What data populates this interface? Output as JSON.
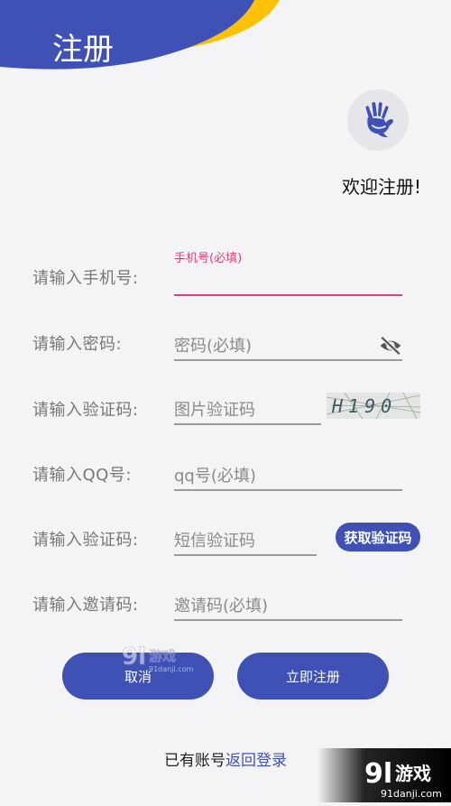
{
  "header": {
    "title": "注册"
  },
  "welcome": "欢迎注册!",
  "form": {
    "phone": {
      "label": "请输入手机号:",
      "floating_label": "手机号(必填)"
    },
    "password": {
      "label": "请输入密码:",
      "placeholder": "密码(必填)"
    },
    "captcha": {
      "label": "请输入验证码:",
      "placeholder": "图片验证码",
      "image_text": "H190"
    },
    "qq": {
      "label": "请输入QQ号:",
      "placeholder": "qq号(必填)"
    },
    "sms": {
      "label": "请输入验证码:",
      "placeholder": "短信验证码",
      "button_label": "获取验证码"
    },
    "invite": {
      "label": "请输入邀请码:",
      "placeholder": "邀请码(必填)"
    }
  },
  "actions": {
    "cancel_label": "取消",
    "register_label": "立即注册"
  },
  "footer": {
    "text": "已有账号",
    "link_label": "返回登录"
  },
  "watermark": {
    "brand": "游戏",
    "url": "91danji.com"
  },
  "colors": {
    "primary": "#3f51b5",
    "accent_pink": "#e0417c",
    "yellow": "#ffc107"
  },
  "icons": {
    "avatar": "waving-hand-icon",
    "password_toggle": "eye-off-icon"
  }
}
